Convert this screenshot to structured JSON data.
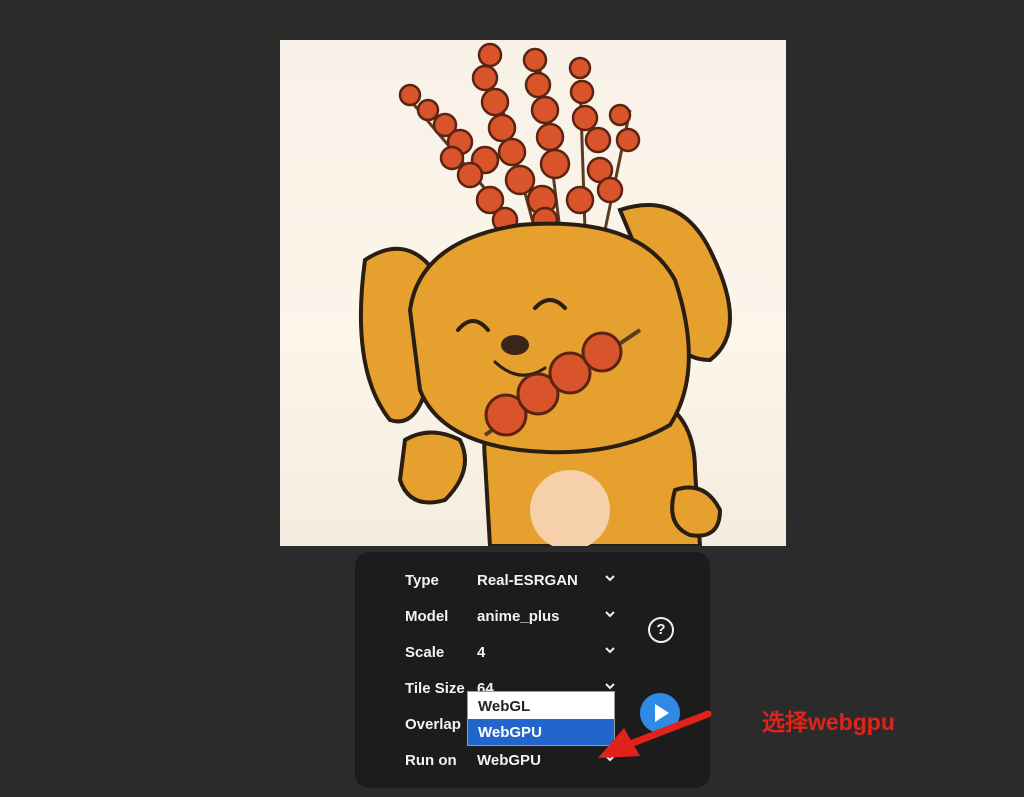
{
  "form": {
    "rows": [
      {
        "label": "Type",
        "value": "Real-ESRGAN"
      },
      {
        "label": "Model",
        "value": "anime_plus"
      },
      {
        "label": "Scale",
        "value": "4"
      },
      {
        "label": "Tile Size",
        "value": "64"
      },
      {
        "label": "Overlap",
        "value": ""
      },
      {
        "label": "Run on",
        "value": "WebGPU"
      }
    ],
    "help_label": "?",
    "play_icon": "play-icon"
  },
  "dropdown": {
    "options": [
      "WebGL",
      "WebGPU"
    ],
    "selected": "WebGPU"
  },
  "annotation": {
    "text": "选择webgpu",
    "color": "#e0221b"
  },
  "colors": {
    "background": "#2b2b2b",
    "panel": "#1c1c1c",
    "accent": "#2f8ae6",
    "selected_option": "#2266cc"
  }
}
